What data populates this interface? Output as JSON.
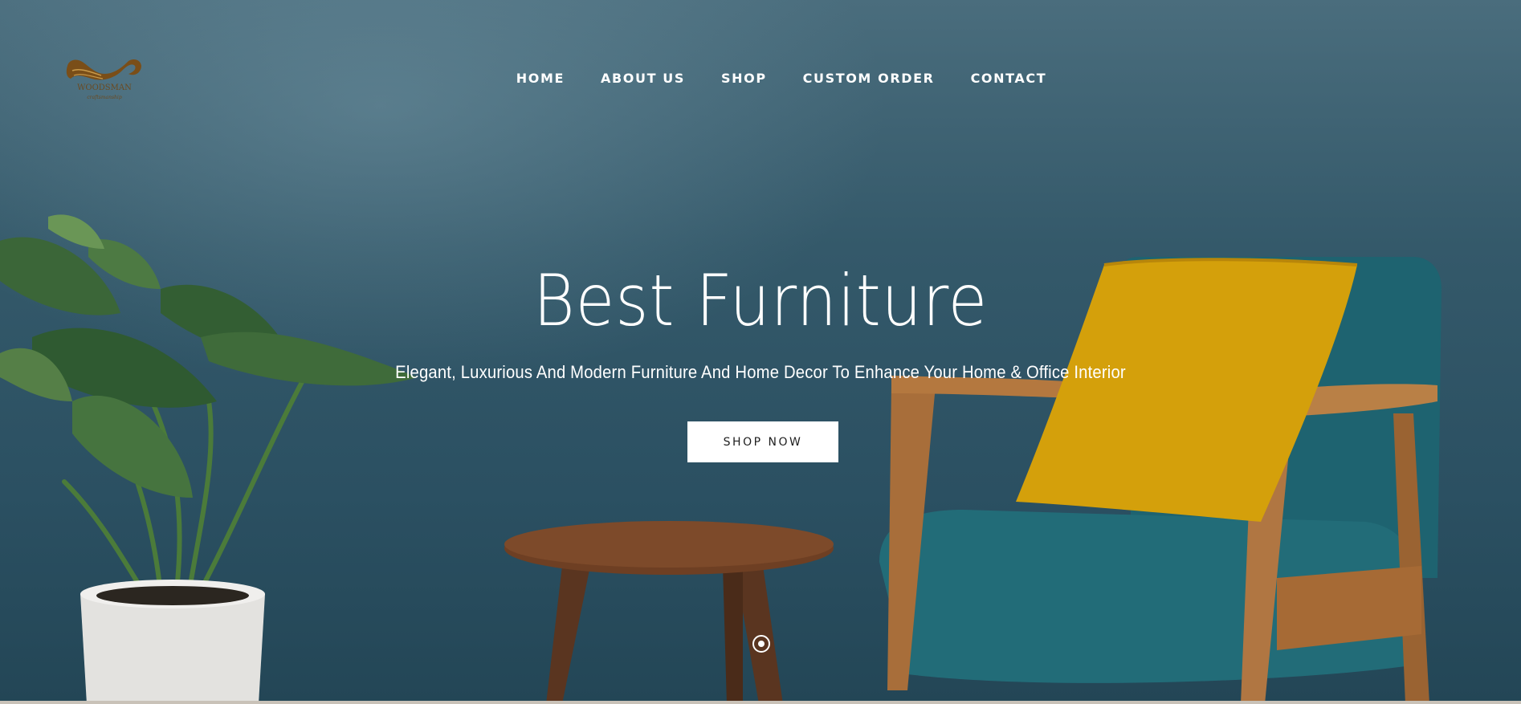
{
  "logo": {
    "text": "WOODSMAN",
    "tagline": "craftsmanship",
    "color": "#8a5a1c"
  },
  "nav": {
    "items": [
      {
        "label": "HOME"
      },
      {
        "label": "ABOUT US"
      },
      {
        "label": "SHOP"
      },
      {
        "label": "CUSTOM ORDER"
      },
      {
        "label": "CONTACT"
      }
    ]
  },
  "hero": {
    "title": "Best Furniture",
    "subtitle": "Elegant, Luxurious And Modern Furniture And Home Decor To Enhance Your Home & Office Interior",
    "cta_label": "SHOP NOW",
    "background_color": "#2f5566",
    "slider": {
      "active_index": 1,
      "count": 1
    }
  },
  "colors": {
    "wall": "#2f5566",
    "pillow": "#d4a00b",
    "chair_fabric": "#1f6a74",
    "wood": "#a9703c",
    "table": "#6b3f24",
    "pot": "#e6e6e4",
    "leaf": "#3f6b3a"
  }
}
